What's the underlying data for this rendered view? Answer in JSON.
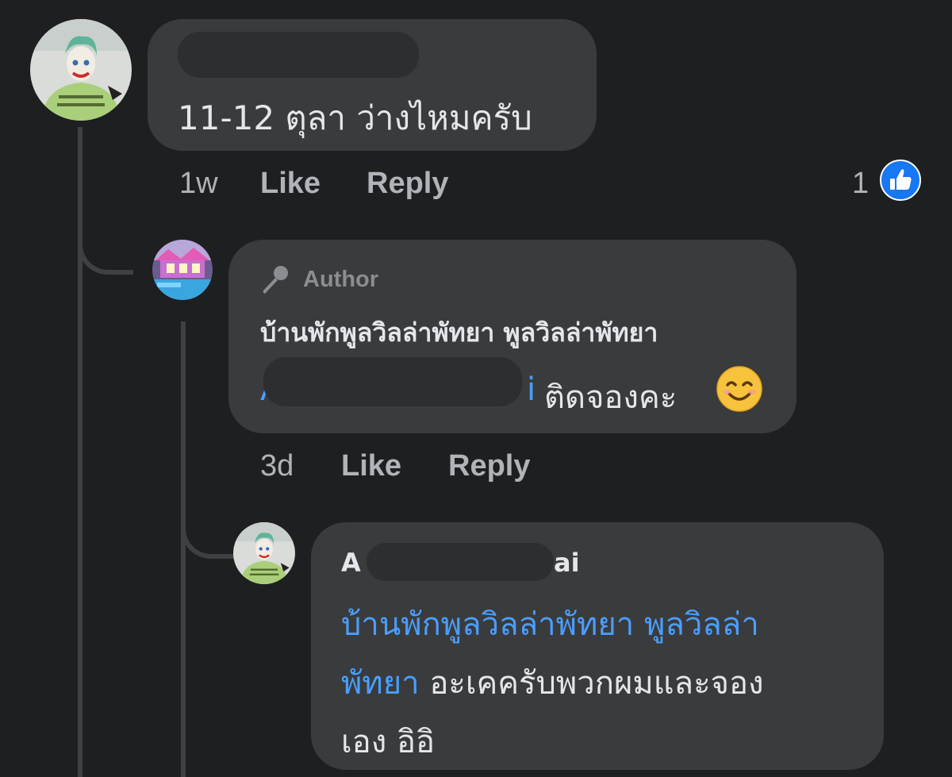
{
  "comments": [
    {
      "name_redacted": true,
      "text": "11-12 ตุลา ว่างไหมครับ",
      "time": "1w",
      "like_label": "Like",
      "reply_label": "Reply",
      "reaction_count": "1",
      "reaction_icon": "like-icon"
    },
    {
      "badge": "Author",
      "badge_icon": "microphone-icon",
      "author_name": "บ้านพักพูลวิลล่าพัทยา พูลวิลล่าพัทยา",
      "mention_prefix": "A",
      "mention_suffix": "i",
      "text": "ติดจองคะ",
      "emoji": "😊",
      "time": "3d",
      "like_label": "Like",
      "reply_label": "Reply"
    },
    {
      "name_prefix": "A",
      "name_suffix": "ai",
      "mention_line1": "บ้านพักพูลวิลล่าพัทยา พูลวิลล่า",
      "mention_line2": "พัทยา",
      "text_line2": " อะเคครับพวกผมและจอง",
      "text_line3": "เอง อิอิ"
    }
  ],
  "colors": {
    "background": "#1e1f21",
    "bubble": "#3a3b3c",
    "link": "#4a9eff",
    "like_blue": "#1877f2"
  }
}
